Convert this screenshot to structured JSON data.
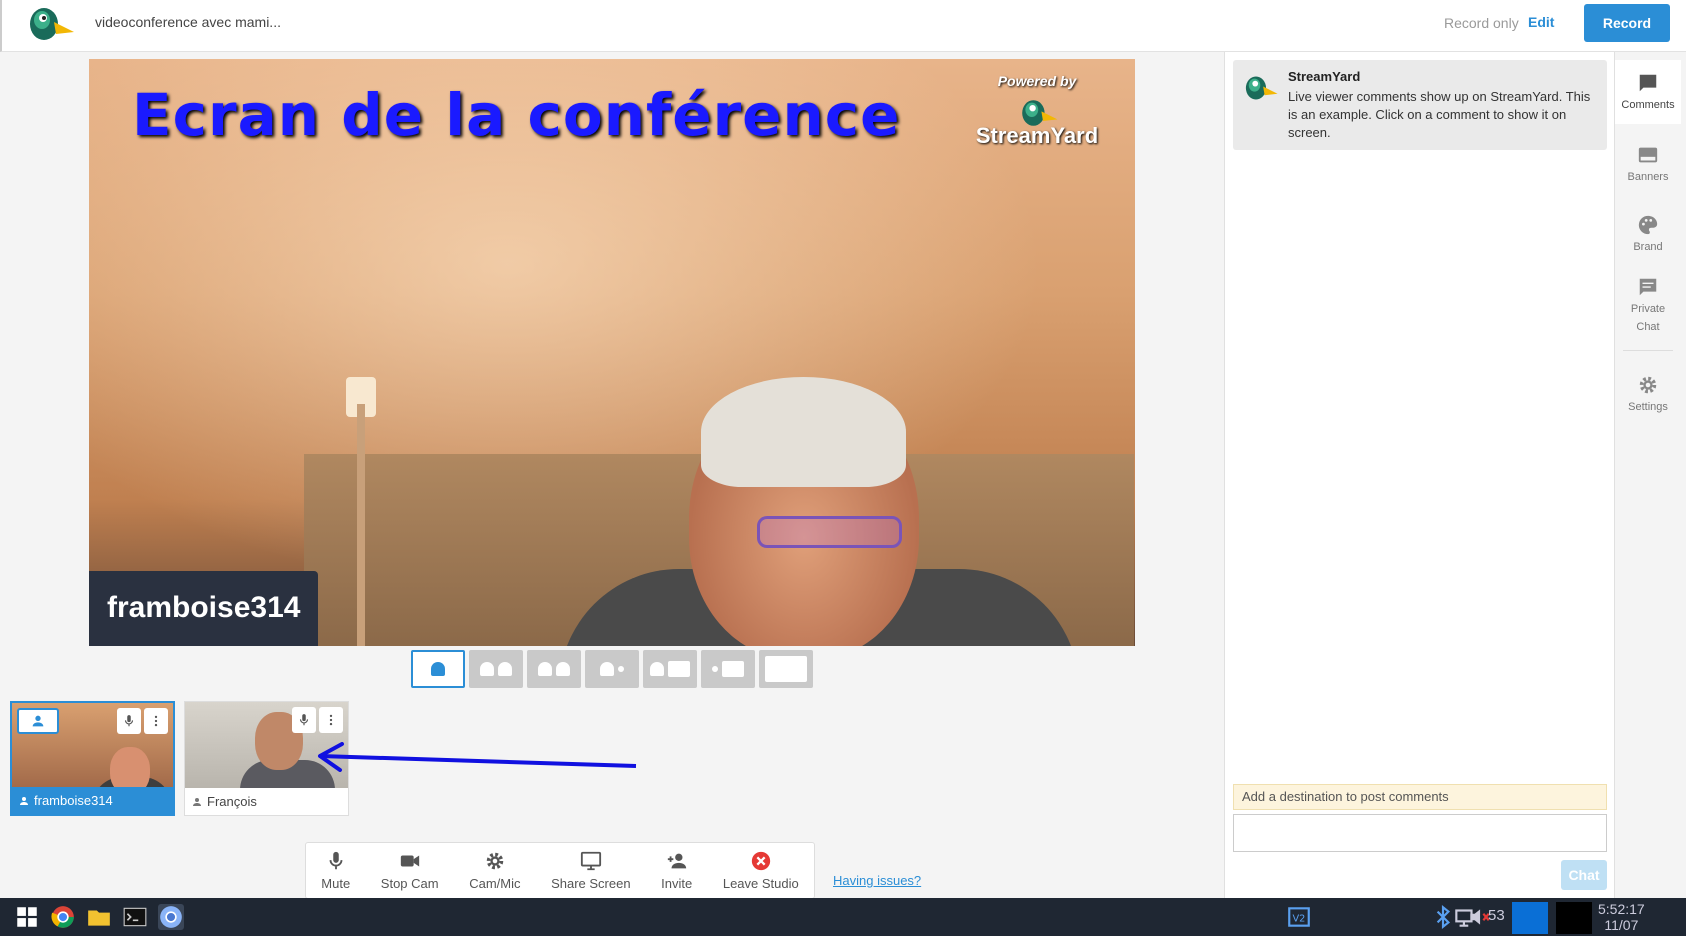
{
  "header": {
    "title": "videoconference avec mami...",
    "record_only": "Record only",
    "edit": "Edit",
    "record": "Record"
  },
  "stage": {
    "title": "Ecran de la conférence",
    "powered_by": "Powered by",
    "brand": "StreamYard",
    "name_plate": "framboise314"
  },
  "layouts": [
    "solo",
    "group",
    "group-split",
    "thin",
    "picture-in-picture",
    "cinema",
    "screen-only"
  ],
  "participants": [
    {
      "name": "framboise314",
      "selected": true
    },
    {
      "name": "François",
      "selected": false
    }
  ],
  "controls": {
    "mute": "Mute",
    "stop_cam": "Stop Cam",
    "cam_mic": "Cam/Mic",
    "share_screen": "Share Screen",
    "invite": "Invite",
    "leave": "Leave Studio"
  },
  "having_issues": "Having issues?",
  "comments_panel": {
    "comment": {
      "author": "StreamYard",
      "text": "Live viewer comments show up on StreamYard. This is an example. Click on a comment to show it on screen."
    },
    "destination_notice": "Add a destination to post comments",
    "chat_button": "Chat"
  },
  "rail": {
    "comments": "Comments",
    "banners": "Banners",
    "brand": "Brand",
    "private_chat_1": "Private",
    "private_chat_2": "Chat",
    "settings": "Settings"
  },
  "taskbar": {
    "volume_level": "53",
    "time": "5:52:17",
    "date": "11/07"
  },
  "colors": {
    "accent": "#2b8ed6",
    "name_plate_bg": "#2a3140",
    "leave_red": "#e53935",
    "taskbar_bg": "#1f2733"
  }
}
